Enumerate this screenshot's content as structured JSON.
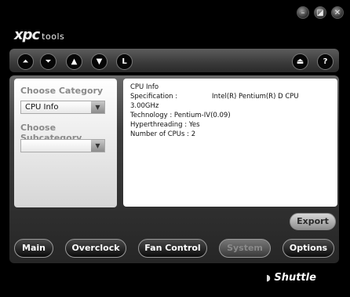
{
  "window": {
    "logo_prefix": "xpc",
    "logo_suffix": "tools",
    "controls": [
      "minimize-icon",
      "restore-icon",
      "close-icon"
    ]
  },
  "toolbar": {
    "buttons_left": [
      "top-icon",
      "bottom-icon",
      "up-icon",
      "down-icon",
      "L"
    ],
    "buttons_right": [
      "eject-icon",
      "?"
    ]
  },
  "sidebar": {
    "category_label": "Choose Category",
    "category_value": "CPU Info",
    "subcategory_label": "Choose Subcategory",
    "subcategory_value": ""
  },
  "info": {
    "lines": [
      "CPU Info",
      "Specification :",
      "Intel(R) Pentium(R) D CPU",
      "3.00GHz",
      "Technology : Pentium-IV(0.09)",
      "Hyperthreading : Yes",
      "Number of CPUs : 2"
    ]
  },
  "actions": {
    "export": "Export"
  },
  "nav": {
    "buttons": [
      "Main",
      "Overclock",
      "Fan Control",
      "System",
      "Options"
    ],
    "active": "System"
  },
  "brand": "Shuttle"
}
